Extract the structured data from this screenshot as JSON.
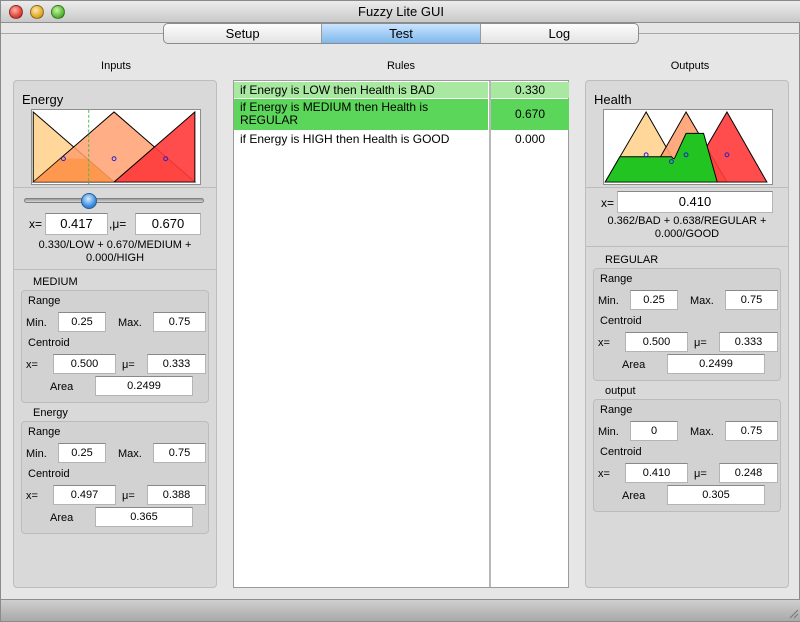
{
  "window": {
    "title": "Fuzzy Lite GUI"
  },
  "tabs": [
    {
      "label": "Setup"
    },
    {
      "label": "Test"
    },
    {
      "label": "Log"
    }
  ],
  "columns": {
    "inputs": "Inputs",
    "rules": "Rules",
    "outputs": "Outputs"
  },
  "inputs": {
    "variable_name": "Energy",
    "slider_value": 0.417,
    "x_label": "x=",
    "x_value": "0.417",
    "mu_label": ",μ=",
    "mu_value": "0.670",
    "fuzzification_line1": "0.330/LOW + 0.670/MEDIUM +",
    "fuzzification_line2": "0.000/HIGH",
    "term": {
      "title": "MEDIUM",
      "range_label": "Range",
      "min_label": "Min.",
      "min_value": "0.25",
      "max_label": "Max.",
      "max_value": "0.75",
      "centroid_label": "Centroid",
      "cx_label": "x=",
      "cx_value": "0.500",
      "cmu_label": "μ=",
      "cmu_value": "0.333",
      "area_label": "Area",
      "area_value": "0.2499"
    },
    "variable": {
      "title": "Energy",
      "range_label": "Range",
      "min_label": "Min.",
      "min_value": "0.25",
      "max_label": "Max.",
      "max_value": "0.75",
      "centroid_label": "Centroid",
      "cx_label": "x=",
      "cx_value": "0.497",
      "cmu_label": "μ=",
      "cmu_value": "0.388",
      "area_label": "Area",
      "area_value": "0.365"
    }
  },
  "rules": [
    {
      "line1": "if Energy is LOW then Health is BAD",
      "line2": "",
      "value": "0.330",
      "highlight": "#a8e8a0"
    },
    {
      "line1": "if Energy is MEDIUM then Health is",
      "line2": "REGULAR",
      "value": "0.670",
      "highlight": "#5cd65a"
    },
    {
      "line1": "if Energy is HIGH then Health is GOOD",
      "line2": "",
      "value": "0.000",
      "highlight": "#ffffff"
    }
  ],
  "outputs": {
    "variable_name": "Health",
    "x_label": "x=",
    "x_value": "0.410",
    "defuzz_line1": "0.362/BAD + 0.638/REGULAR +",
    "defuzz_line2": "0.000/GOOD",
    "term": {
      "title": "REGULAR",
      "range_label": "Range",
      "min_label": "Min.",
      "min_value": "0.25",
      "max_label": "Max.",
      "max_value": "0.75",
      "centroid_label": "Centroid",
      "cx_label": "x=",
      "cx_value": "0.500",
      "cmu_label": "μ=",
      "cmu_value": "0.333",
      "area_label": "Area",
      "area_value": "0.2499"
    },
    "variable": {
      "title": "output",
      "range_label": "Range",
      "min_label": "Min.",
      "min_value": "0",
      "max_label": "Max.",
      "max_value": "0.75",
      "centroid_label": "Centroid",
      "cx_label": "x=",
      "cx_value": "0.410",
      "cmu_label": "μ=",
      "cmu_value": "0.248",
      "area_label": "Area",
      "area_value": "0.305"
    }
  },
  "colors": {
    "low": "#ffd79a",
    "medium": "#ffa070",
    "high": "#ff3a3a",
    "output_fill": "#22c422",
    "tab_active": "#7fb8ec"
  }
}
